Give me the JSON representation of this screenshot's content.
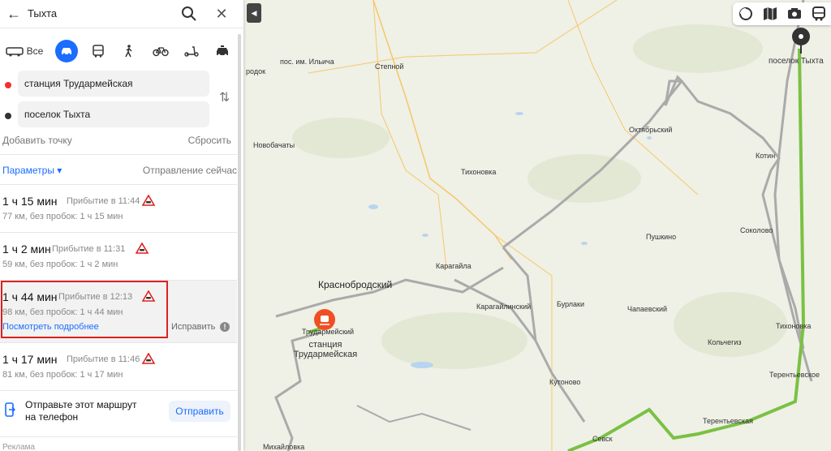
{
  "search": {
    "query": "Тыхта"
  },
  "modes": {
    "all_label": "Все"
  },
  "points": {
    "from": "станция Трудармейская",
    "to": "поселок Тыхта",
    "add": "Добавить точку",
    "reset": "Сбросить"
  },
  "params": {
    "label": "Параметры ▾",
    "departure": "Отправление сейчас"
  },
  "routes": [
    {
      "time": "1 ч 15 мин",
      "arrival": "Прибытие в 11:44",
      "details": "77 км, без пробок: 1 ч 15 мин"
    },
    {
      "time": "1 ч 2 мин",
      "arrival": "Прибытие в 11:31",
      "details": "59 км, без пробок: 1 ч 2 мин"
    },
    {
      "time": "1 ч 44 мин",
      "arrival": "Прибытие в 12:13",
      "details": "98 км, без пробок: 1 ч 44 мин",
      "more": "Посмотреть подробнее",
      "fix": "Исправить"
    },
    {
      "time": "1 ч 17 мин",
      "arrival": "Прибытие в 11:46",
      "details": "81 км, без пробок: 1 ч 17 мин"
    }
  ],
  "send": {
    "text": "Отправьте этот маршрут на телефон",
    "button": "Отправить"
  },
  "ad": "Реклама",
  "map_labels": {
    "l1": "пос. им. Ильича",
    "l2": "Степной",
    "l3": "родок",
    "l4": "Новобачаты",
    "l5": "Тихоновка",
    "l6": "Октябрьский",
    "l7": "Котин",
    "l8": "поселок Тыхта",
    "l9": "Соколово",
    "l10": "Пушкино",
    "l11": "Карагайла",
    "l12": "Краснобродский",
    "l13": "Карагайлинский",
    "l14": "Бурлаки",
    "l15": "Чапаевский",
    "l16": "Кольчегиз",
    "l17": "Тихоновка",
    "l18": "Терентьевское",
    "l19": "Кутоново",
    "l20": "Терентьевская",
    "l21": "Севск",
    "l22": "Михайловка",
    "l23": "Трудармейский",
    "l24": "станция Трудармейская"
  }
}
